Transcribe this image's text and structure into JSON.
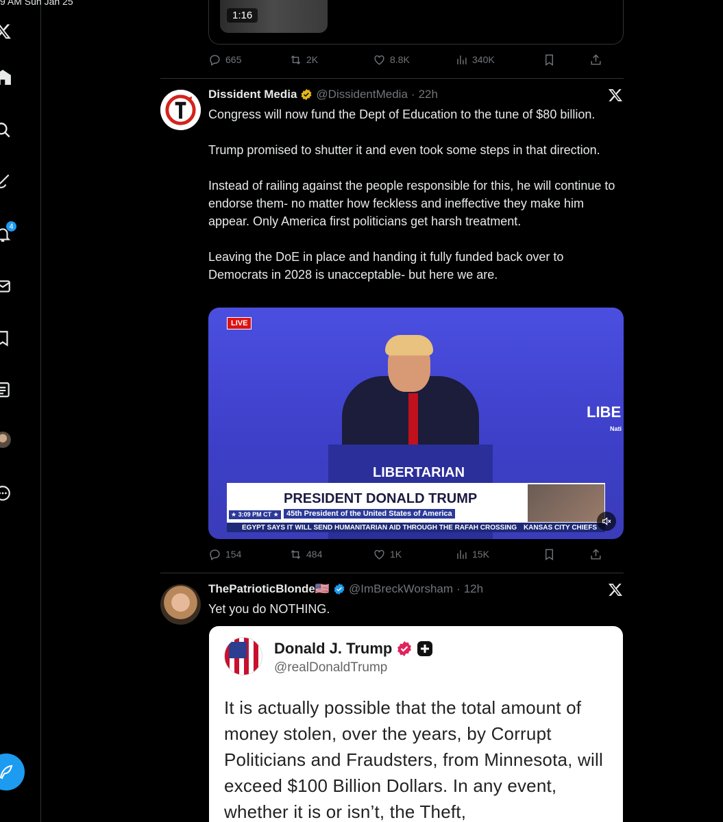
{
  "status_bar": {
    "text": "9 AM  Sun Jan 25"
  },
  "sidebar": {
    "items": [
      {
        "name": "x-logo-icon"
      },
      {
        "name": "home-icon"
      },
      {
        "name": "search-icon"
      },
      {
        "name": "grok-icon"
      },
      {
        "name": "notifications-icon"
      },
      {
        "name": "messages-icon"
      },
      {
        "name": "bookmarks-icon"
      },
      {
        "name": "lists-icon"
      },
      {
        "name": "profile-avatar"
      },
      {
        "name": "more-icon"
      }
    ],
    "notification_count": "4",
    "post_button_icon": "compose-feather-icon"
  },
  "top_post": {
    "video_duration": "1:16",
    "stats": {
      "replies": "665",
      "reposts": "2K",
      "likes": "8.8K",
      "views": "340K"
    }
  },
  "post1": {
    "name": "Dissident Media",
    "handle": "@DissidentMedia",
    "time": "22h",
    "paragraphs": [
      "Congress will now fund the Dept of Education to the tune of $80 billion.",
      "Trump promised to shutter it and even took some steps in that direction.",
      "Instead of railing against the people responsible for this, he will continue to endorse them- no matter how feckless and ineffective they make him appear. Only America first politicians get harsh treatment.",
      "Leaving the DoE in place and handing it fully funded back over to Democrats in 2028 is unacceptable- but here we are."
    ],
    "video": {
      "live": "LIVE",
      "podium": "LIBERTARIAN",
      "side_text": "LIBE",
      "side_small": "Nati",
      "lower_third_name": "PRESIDENT DONALD TRUMP",
      "lower_third_sub": "45th President of the United States of America",
      "lower_third_time": "★ 3:09 PM CT ★",
      "ticker_left": "EGYPT SAYS IT WILL SEND HUMANITARIAN AID THROUGH THE RAFAH CROSSING",
      "ticker_right": "KANSAS CITY CHIEFS"
    },
    "stats": {
      "replies": "154",
      "reposts": "484",
      "likes": "1K",
      "views": "15K"
    }
  },
  "post2": {
    "name": "ThePatrioticBlonde🇺🇸",
    "handle": "@ImBreckWorsham",
    "time": "12h",
    "text": "Yet you do NOTHING.",
    "embed": {
      "name": "Donald J. Trump",
      "handle": "@realDonaldTrump",
      "text": "It is actually possible that the total amount of money stolen, over the years, by Corrupt Politicians and Fraudsters, from Minnesota, will exceed $100 Billion Dollars. In any event, whether it is or isn’t, the Theft,"
    }
  },
  "colors": {
    "accent": "#1d9bf0",
    "muted": "#71767b",
    "verified_gold": "#e2b719",
    "truth_badge": "#e0245e"
  }
}
